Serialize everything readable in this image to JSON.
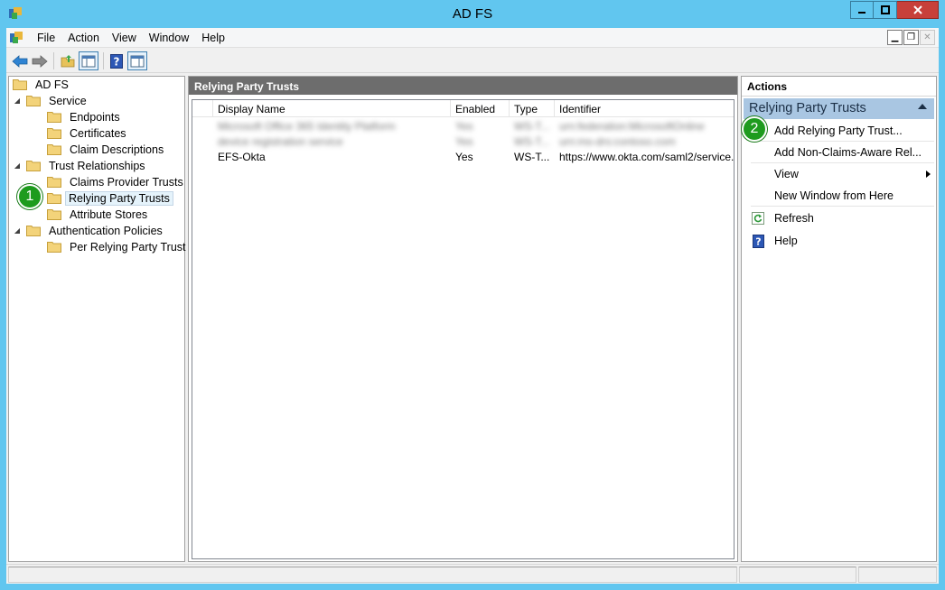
{
  "window": {
    "title": "AD FS",
    "colors": {
      "titlebar": "#61c6ef",
      "close": "#c7403a",
      "badge": "#1e9b1e",
      "actions_group": "#a9c6e2"
    }
  },
  "menubar": {
    "items": [
      "File",
      "Action",
      "View",
      "Window",
      "Help"
    ]
  },
  "tree": {
    "items": [
      {
        "label": "AD FS"
      },
      {
        "label": "Service"
      },
      {
        "label": "Endpoints"
      },
      {
        "label": "Certificates"
      },
      {
        "label": "Claim Descriptions"
      },
      {
        "label": "Trust Relationships"
      },
      {
        "label": "Claims Provider Trusts"
      },
      {
        "label": "Relying Party Trusts"
      },
      {
        "label": "Attribute Stores"
      },
      {
        "label": "Authentication Policies"
      },
      {
        "label": "Per Relying Party Trust"
      }
    ]
  },
  "center": {
    "title": "Relying Party Trusts",
    "columns": [
      "Display Name",
      "Enabled",
      "Type",
      "Identifier"
    ],
    "rows": [
      {
        "name": "Microsoft Office 365 Identity Platform",
        "enabled": "Yes",
        "type": "WS-T...",
        "identifier": "urn:federation:MicrosoftOnline"
      },
      {
        "name": "device registration service",
        "enabled": "Yes",
        "type": "WS-T...",
        "identifier": "urn:ms-drs:contoso.com"
      },
      {
        "name": "EFS-Okta",
        "enabled": "Yes",
        "type": "WS-T...",
        "identifier": "https://www.okta.com/saml2/service..."
      }
    ]
  },
  "actions": {
    "header": "Actions",
    "group": "Relying Party Trusts",
    "items": [
      {
        "label": "Add Relying Party Trust..."
      },
      {
        "label": "Add Non-Claims-Aware Rel..."
      },
      {
        "label": "View"
      },
      {
        "label": "New Window from Here"
      },
      {
        "label": "Refresh"
      },
      {
        "label": "Help"
      }
    ]
  },
  "callouts": {
    "one": "1",
    "two": "2"
  },
  "icons": {
    "app": "adfs-icon",
    "back": "back-arrow-icon",
    "forward": "forward-arrow-icon",
    "up": "up-folder-icon",
    "show_tree": "show-hide-tree-icon",
    "help": "help-icon",
    "show_actions": "show-hide-action-pane-icon",
    "folder": "folder-icon",
    "refresh": "refresh-icon"
  }
}
